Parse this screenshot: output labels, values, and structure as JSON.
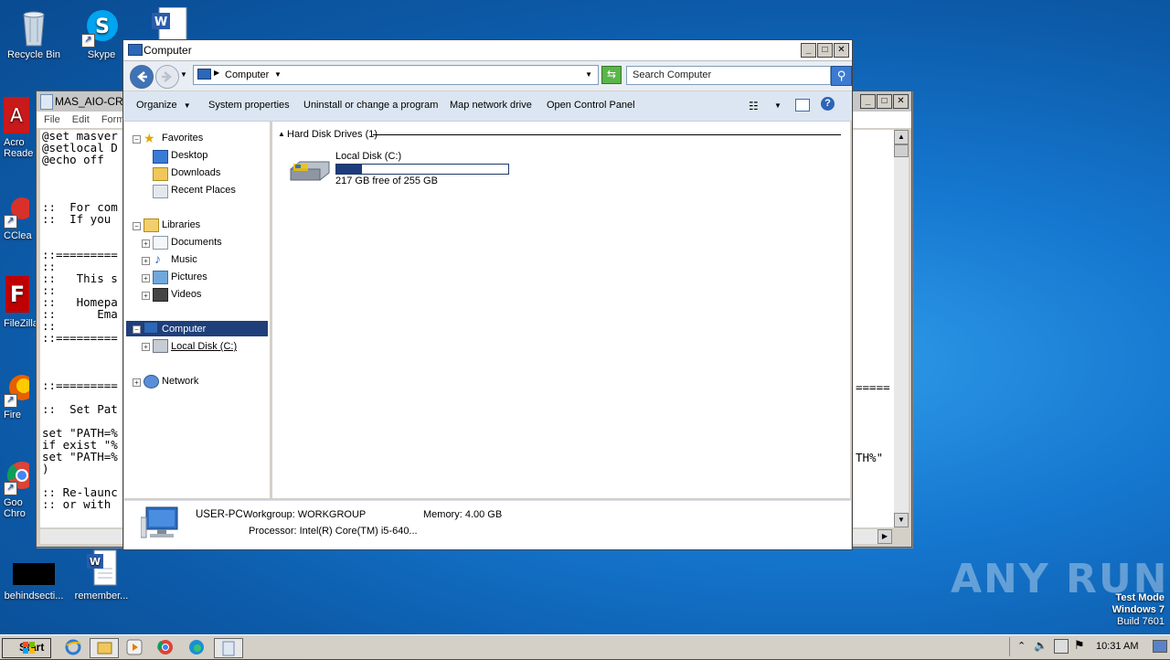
{
  "desktop": {
    "icons": [
      {
        "label": "Recycle Bin"
      },
      {
        "label": "Skype"
      },
      {
        "label": "Acro Reade"
      },
      {
        "label": "CClea"
      },
      {
        "label": "FileZilla"
      },
      {
        "label": "Fire"
      },
      {
        "label": "Goo Chro"
      },
      {
        "label": "behindsecti..."
      },
      {
        "label": "remember..."
      }
    ],
    "watermark": "ANY RUN",
    "test_mode": {
      "line1": "Test Mode",
      "line2": "Windows 7",
      "line3": "Build 7601"
    }
  },
  "notepad": {
    "title": "MAS_AIO-CR",
    "menu": [
      "File",
      "Edit",
      "Forma"
    ],
    "lines": [
      "@set masver",
      "@setlocal D",
      "@echo off",
      "",
      "",
      "",
      "::  For com",
      "::  If you",
      "",
      "",
      "::=========",
      "::",
      "::   This s",
      "::",
      "::   Homepa",
      "::      Ema",
      "::",
      "::=========",
      "",
      "",
      "",
      "::=========",
      "",
      "::  Set Pat",
      "",
      "set \"PATH=%",
      "if exist \"%",
      "set \"PATH=%",
      ")",
      "",
      ":: Re-launc",
      ":: or with"
    ],
    "right_fragments": [
      "=====",
      "TH%\""
    ]
  },
  "explorer": {
    "title": "Computer",
    "address": "Computer",
    "search_placeholder": "Search Computer",
    "toolbar": [
      "Organize",
      "System properties",
      "Uninstall or change a program",
      "Map network drive",
      "Open Control Panel"
    ],
    "tree": {
      "favorites": "Favorites",
      "fav_items": [
        "Desktop",
        "Downloads",
        "Recent Places"
      ],
      "libraries": "Libraries",
      "lib_items": [
        "Documents",
        "Music",
        "Pictures",
        "Videos"
      ],
      "computer": "Computer",
      "local_disk": "Local Disk (C:)",
      "network": "Network"
    },
    "group_header": "Hard Disk Drives (1)",
    "drive": {
      "name": "Local Disk (C:)",
      "free_text": "217 GB free of 255 GB",
      "used_fraction": 0.149
    },
    "status": {
      "name": "USER-PC",
      "workgroup": "Workgroup: WORKGROUP",
      "memory": "Memory: 4.00 GB",
      "processor": "Processor: Intel(R) Core(TM) i5-640..."
    }
  },
  "taskbar": {
    "start": "Start",
    "clock": "10:31 AM"
  }
}
